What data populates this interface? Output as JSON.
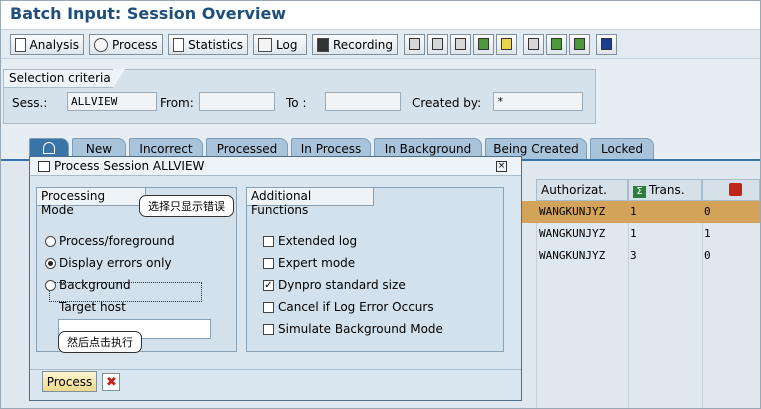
{
  "window": {
    "title": "Batch Input: Session Overview"
  },
  "toolbar": {
    "buttons": [
      {
        "label": "Analysis",
        "icon": "analysis-icon"
      },
      {
        "label": "Process",
        "icon": "process-icon"
      },
      {
        "label": "Statistics",
        "icon": "statistics-icon"
      },
      {
        "label": "Log",
        "icon": "log-icon"
      },
      {
        "label": "Recording",
        "icon": "recording-icon"
      }
    ],
    "icon_buttons": [
      "delete-icon",
      "lock-icon",
      "unlock-icon",
      "flag-icon",
      "filter-icon",
      "print-icon",
      "export-icon",
      "import-icon",
      "info-icon"
    ]
  },
  "selection": {
    "title": "Selection criteria",
    "sess_label": "Sess.:",
    "sess_value": "ALLVIEW",
    "from_label": "From:",
    "from_value": "",
    "to_label": "To :",
    "to_value": "",
    "created_label": "Created by:",
    "created_value": "*"
  },
  "tabs": [
    {
      "label": "",
      "icon": "all-icon",
      "active": true
    },
    {
      "label": "New"
    },
    {
      "label": "Incorrect"
    },
    {
      "label": "Processed"
    },
    {
      "label": "In Process"
    },
    {
      "label": "In Background"
    },
    {
      "label": "Being Created"
    },
    {
      "label": "Locked"
    }
  ],
  "table": {
    "headers": {
      "authorizat": "Authorizat.",
      "trans": "Trans.",
      "trans_icon": "sum-icon",
      "err_icon": "error-icon"
    },
    "rows": [
      {
        "authorizat": "WANGKUNJYZ",
        "trans": "1",
        "err": "0",
        "selected": true
      },
      {
        "authorizat": "WANGKUNJYZ",
        "trans": "1",
        "err": "1"
      },
      {
        "authorizat": "WANGKUNJYZ",
        "trans": "3",
        "err": "0"
      }
    ]
  },
  "dialog": {
    "title": "Process Session ALLVIEW",
    "processing_mode": {
      "title": "Processing Mode",
      "options": [
        "Process/foreground",
        "Display errors only",
        "Background"
      ],
      "selected": 1,
      "target_host_label": "Target host",
      "target_host_value": ""
    },
    "additional": {
      "title": "Additional Functions",
      "options": [
        {
          "label": "Extended log",
          "checked": false
        },
        {
          "label": "Expert mode",
          "checked": false
        },
        {
          "label": "Dynpro standard size",
          "checked": true
        },
        {
          "label": "Cancel if Log Error Occurs",
          "checked": false
        },
        {
          "label": "Simulate Background Mode",
          "checked": false
        }
      ]
    },
    "process_button": "Process",
    "cancel_icon": "cancel-icon"
  },
  "callouts": {
    "c1": "选择只显示错误",
    "c2": "然后点击执行"
  },
  "colors": {
    "title": "#1e4e7c",
    "active_tab": "#3a73a7",
    "selected_row": "#d4a35a"
  }
}
